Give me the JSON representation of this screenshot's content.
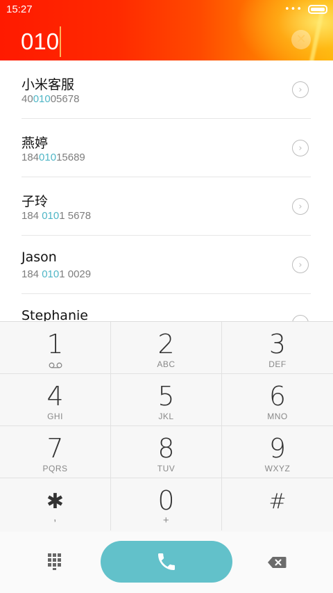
{
  "status_bar": {
    "time": "15:27",
    "dots": "•••"
  },
  "dialer": {
    "input_value": "010"
  },
  "contacts": [
    {
      "name": "小米客服",
      "num_pre": "40",
      "num_match": "010",
      "num_post": "05678"
    },
    {
      "name": "燕婷",
      "num_pre": "184",
      "num_match": "010",
      "num_post": "15689"
    },
    {
      "name": "子玲",
      "num_pre": "184 ",
      "num_match": "010",
      "num_post": "1 5678"
    },
    {
      "name": "Jason",
      "num_pre": "184 ",
      "num_match": "010",
      "num_post": "1 0029"
    },
    {
      "name": "Stephanie",
      "num_pre": "",
      "num_match": "",
      "num_post": ""
    }
  ],
  "keypad": [
    {
      "digit": "1",
      "letters": ""
    },
    {
      "digit": "2",
      "letters": "ABC"
    },
    {
      "digit": "3",
      "letters": "DEF"
    },
    {
      "digit": "4",
      "letters": "GHI"
    },
    {
      "digit": "5",
      "letters": "JKL"
    },
    {
      "digit": "6",
      "letters": "MNO"
    },
    {
      "digit": "7",
      "letters": "PQRS"
    },
    {
      "digit": "8",
      "letters": "TUV"
    },
    {
      "digit": "9",
      "letters": "WXYZ"
    },
    {
      "digit": "✱",
      "letters": ","
    },
    {
      "digit": "0",
      "letters": "+"
    },
    {
      "digit": "#",
      "letters": ""
    }
  ],
  "icons": {
    "clear": "close-icon",
    "detail": "chevron-right-icon",
    "voicemail": "voicemail-icon",
    "dialpad": "dialpad-icon",
    "call": "phone-icon",
    "backspace": "backspace-icon"
  },
  "colors": {
    "header_start": "#ff1a00",
    "header_end": "#ffb000",
    "accent": "#62c1ca",
    "match_highlight": "#4fb6c6"
  }
}
